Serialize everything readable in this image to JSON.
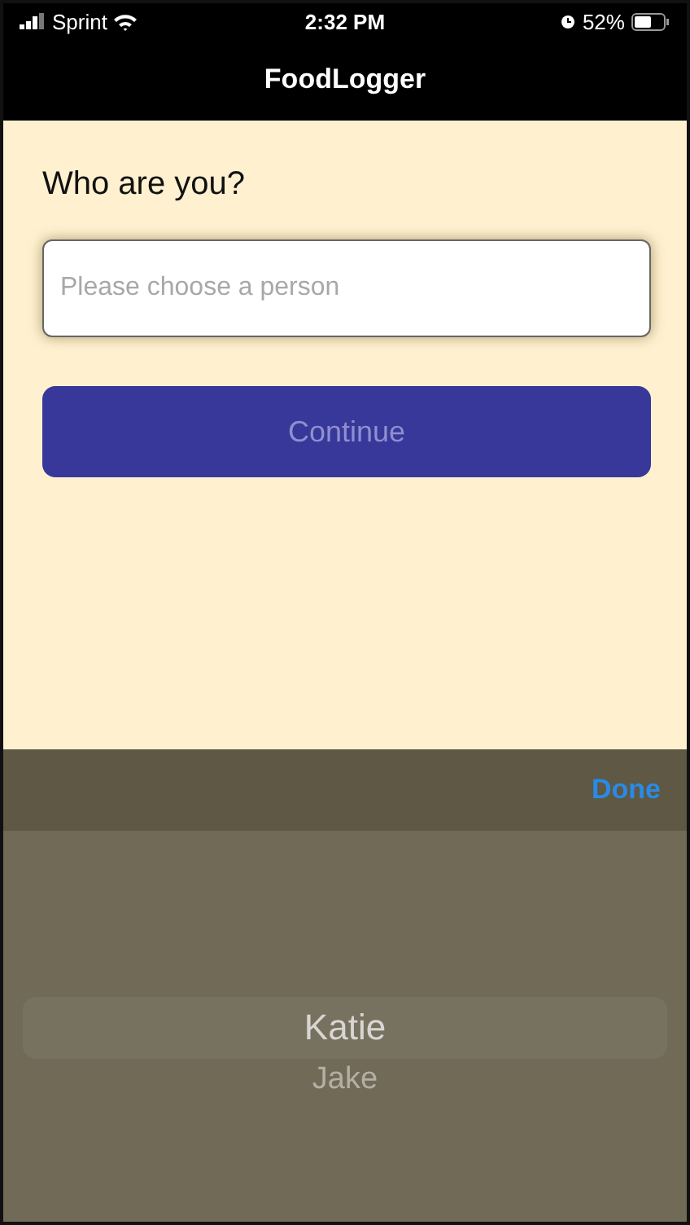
{
  "status_bar": {
    "carrier": "Sprint",
    "time": "2:32 PM",
    "battery": "52%"
  },
  "nav_bar": {
    "title": "FoodLogger"
  },
  "form": {
    "question": "Who are you?",
    "person_field": {
      "placeholder": "Please choose a person"
    },
    "continue_button": {
      "label": "Continue",
      "disabled": true
    }
  },
  "picker": {
    "done_label": "Done",
    "options": [
      {
        "label": "Katie",
        "selected": true
      },
      {
        "label": "Jake",
        "selected": false
      }
    ]
  }
}
